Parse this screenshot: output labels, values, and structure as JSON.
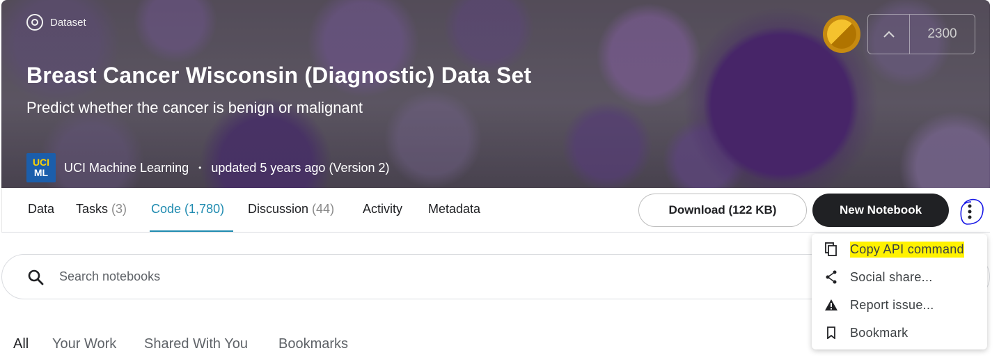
{
  "hero": {
    "badge": "Dataset",
    "title": "Breast Cancer Wisconsin (Diagnostic) Data Set",
    "subtitle": "Predict whether the cancer is benign or malignant",
    "owner_logo_line1": "UCI",
    "owner_logo_line2": "ML",
    "owner": "UCI Machine Learning",
    "separator": "•",
    "updated": "updated 5 years ago (Version 2)",
    "upvote_count": "2300",
    "medal": "gold-medal-icon"
  },
  "tabs": [
    {
      "label": "Data",
      "count": ""
    },
    {
      "label": "Tasks",
      "count": "(3)"
    },
    {
      "label": "Code",
      "count": "(1,780)"
    },
    {
      "label": "Discussion",
      "count": "(44)"
    },
    {
      "label": "Activity",
      "count": ""
    },
    {
      "label": "Metadata",
      "count": ""
    }
  ],
  "active_tab": "Code",
  "actions": {
    "download": "Download (122 KB)",
    "new_notebook": "New Notebook"
  },
  "search": {
    "placeholder": "Search notebooks"
  },
  "filters": [
    "All",
    "Your Work",
    "Shared With You",
    "Bookmarks"
  ],
  "menu": {
    "items": [
      {
        "label": "Copy API command",
        "icon": "copy-icon"
      },
      {
        "label": "Social share...",
        "icon": "share-icon"
      },
      {
        "label": "Report issue...",
        "icon": "warning-icon"
      },
      {
        "label": "Bookmark",
        "icon": "bookmark-icon"
      }
    ]
  },
  "colors": {
    "accent": "#1f8bb0",
    "dark_button": "#202124",
    "highlight": "#fff200",
    "annotation": "#1a1ae6"
  }
}
